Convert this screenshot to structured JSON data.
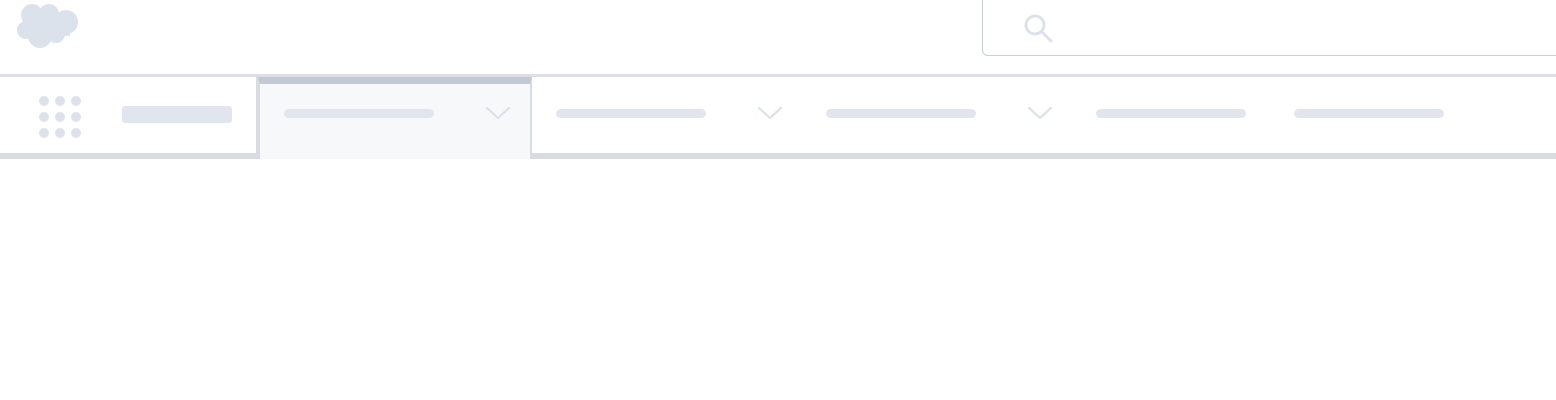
{
  "header": {
    "logo": "salesforce-cloud-logo",
    "search": {
      "placeholder": "",
      "icon": "search-icon"
    }
  },
  "nav": {
    "launcher_icon": "app-launcher-icon",
    "app_name": "",
    "tabs": [
      {
        "label": "",
        "has_menu": true,
        "active": true
      },
      {
        "label": "",
        "has_menu": true,
        "active": false
      },
      {
        "label": "",
        "has_menu": true,
        "active": false
      },
      {
        "label": "",
        "has_menu": false,
        "active": false
      },
      {
        "label": "",
        "has_menu": false,
        "active": false
      }
    ]
  },
  "colors": {
    "placeholder": "#e1e6ee",
    "border": "#d8dce2",
    "active_tab_top": "#c3c9d2",
    "active_tab_bg": "#f7f8fa"
  }
}
